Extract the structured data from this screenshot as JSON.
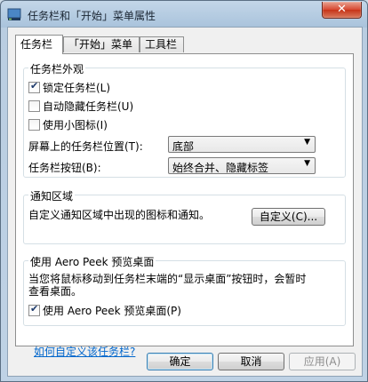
{
  "window": {
    "title": "任务栏和「开始」菜单属性",
    "close_glyph": "✕"
  },
  "tabs": [
    {
      "label": "任务栏",
      "active": true
    },
    {
      "label": "「开始」菜单",
      "active": false
    },
    {
      "label": "工具栏",
      "active": false
    }
  ],
  "appearance": {
    "group_label": "任务栏外观",
    "lock": {
      "label": "锁定任务栏(L)",
      "checked": true
    },
    "autohide": {
      "label": "自动隐藏任务栏(U)",
      "checked": false
    },
    "small_icons": {
      "label": "使用小图标(I)",
      "checked": false
    },
    "location": {
      "label": "屏幕上的任务栏位置(T):",
      "value": "底部"
    },
    "buttons": {
      "label": "任务栏按钮(B):",
      "value": "始终合并、隐藏标签"
    }
  },
  "notification": {
    "group_label": "通知区域",
    "desc": "自定义通知区域中出现的图标和通知。",
    "customize_button": "自定义(C)..."
  },
  "aero": {
    "group_label": "使用 Aero Peek 预览桌面",
    "desc_line1": "当您将鼠标移动到任务栏末端的“显示桌面”按钮时，会暂时",
    "desc_line2": "查看桌面。",
    "checkbox": {
      "label": "使用 Aero Peek 预览桌面(P)",
      "checked": true
    }
  },
  "help_link": "如何自定义该任务栏?",
  "footer": {
    "ok": "确定",
    "cancel": "取消",
    "apply": "应用(A)"
  }
}
